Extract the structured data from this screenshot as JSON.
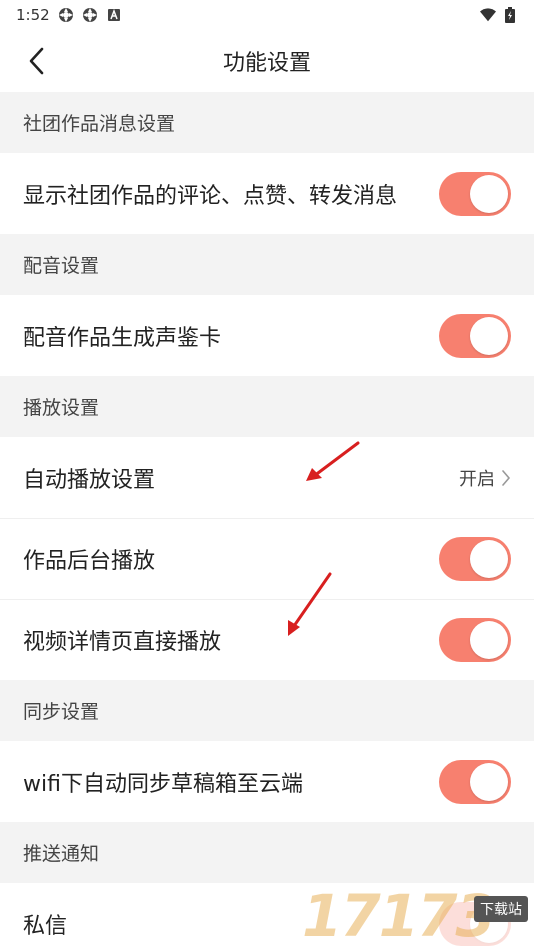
{
  "status_bar": {
    "time": "1:52",
    "icons": [
      "settings-gear-icon",
      "settings-gear-icon",
      "font-a-icon",
      "wifi-icon",
      "battery-icon"
    ]
  },
  "header": {
    "title": "功能设置",
    "back_icon": "chevron-left-icon"
  },
  "sections": [
    {
      "title": "社团作品消息设置",
      "rows": [
        {
          "label": "显示社团作品的评论、点赞、转发消息",
          "toggle": true
        }
      ]
    },
    {
      "title": "配音设置",
      "rows": [
        {
          "label": "配音作品生成声鉴卡",
          "toggle": true
        }
      ]
    },
    {
      "title": "播放设置",
      "rows": [
        {
          "label": "自动播放设置",
          "value": "开启"
        },
        {
          "label": "作品后台播放",
          "toggle": true
        },
        {
          "label": "视频详情页直接播放",
          "toggle": true
        }
      ]
    },
    {
      "title": "同步设置",
      "rows": [
        {
          "label": "wifi下自动同步草稿箱至云端",
          "toggle": true
        }
      ]
    },
    {
      "title": "推送通知",
      "rows": [
        {
          "label": "私信",
          "toggle": true
        }
      ]
    }
  ],
  "colors": {
    "toggle_on": "#f7806f",
    "arrow": "#d81f1f"
  },
  "watermark": {
    "digits": "17173",
    "tag": "下载站"
  }
}
